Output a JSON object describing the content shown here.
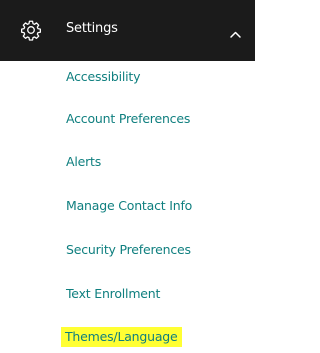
{
  "header": {
    "icon": "gear-icon",
    "title": "Settings",
    "toggle_icon": "chevron-up-icon",
    "background": "#1b1b1b",
    "text_color": "#ffffff"
  },
  "menu": {
    "link_color": "#0f7f7f",
    "highlight_color": "#ffff33",
    "items": [
      {
        "label": "Accessibility"
      },
      {
        "label": "Account Preferences"
      },
      {
        "label": "Alerts"
      },
      {
        "label": "Manage Contact Info"
      },
      {
        "label": "Security Preferences"
      },
      {
        "label": "Text Enrollment"
      },
      {
        "label": "Themes/Language",
        "highlighted": true
      }
    ]
  }
}
